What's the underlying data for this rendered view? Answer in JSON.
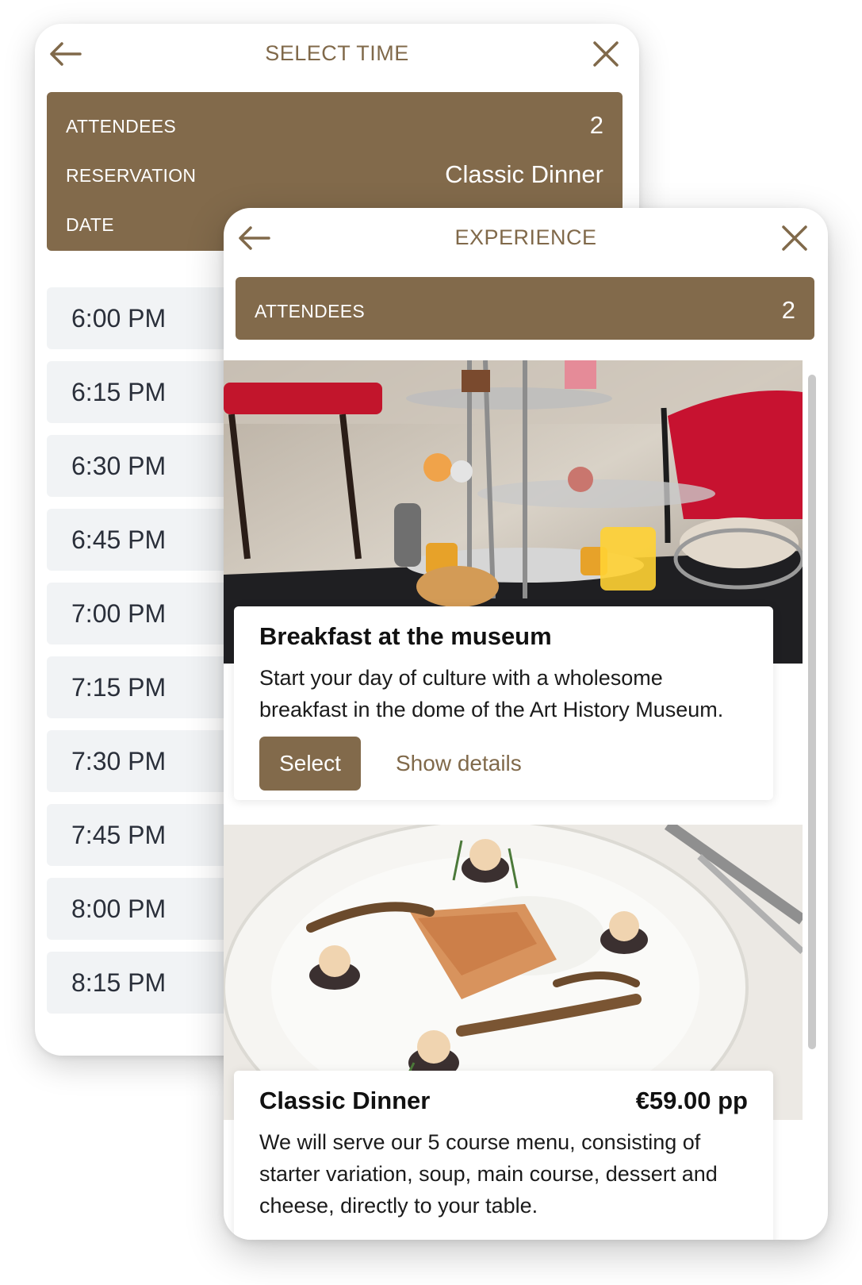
{
  "colors": {
    "accent": "#826a4b",
    "accent_text": "#80694a",
    "slot_bg": "#f1f3f5"
  },
  "select_time_screen": {
    "back_icon": "arrow-left-icon",
    "title": "SELECT TIME",
    "close_icon": "close-icon",
    "summary": {
      "attendees_label": "ATTENDEES",
      "attendees_value": "2",
      "reservation_label": "RESERVATION",
      "reservation_value": "Classic Dinner",
      "date_label": "DATE"
    },
    "time_slots": [
      "6:00 PM",
      "6:15 PM",
      "6:30 PM",
      "6:45 PM",
      "7:00 PM",
      "7:15 PM",
      "7:30 PM",
      "7:45 PM",
      "8:00 PM",
      "8:15 PM"
    ]
  },
  "experience_screen": {
    "back_icon": "arrow-left-icon",
    "title": "EXPERIENCE",
    "close_icon": "close-icon",
    "summary": {
      "attendees_label": "ATTENDEES",
      "attendees_value": "2"
    },
    "experiences": [
      {
        "image": "breakfast-etagere-photo",
        "title": "Breakfast at the museum",
        "description": "Start your day of culture with a wholesome breakfast in the dome of the Art History Museum.",
        "select_label": "Select",
        "details_label": "Show details"
      },
      {
        "image": "salmon-dish-photo",
        "title": "Classic Dinner",
        "price": "€59.00 pp",
        "description": "We will serve our 5 course menu, consisting of starter variation, soup, main course, dessert and cheese, directly to your table."
      }
    ]
  }
}
